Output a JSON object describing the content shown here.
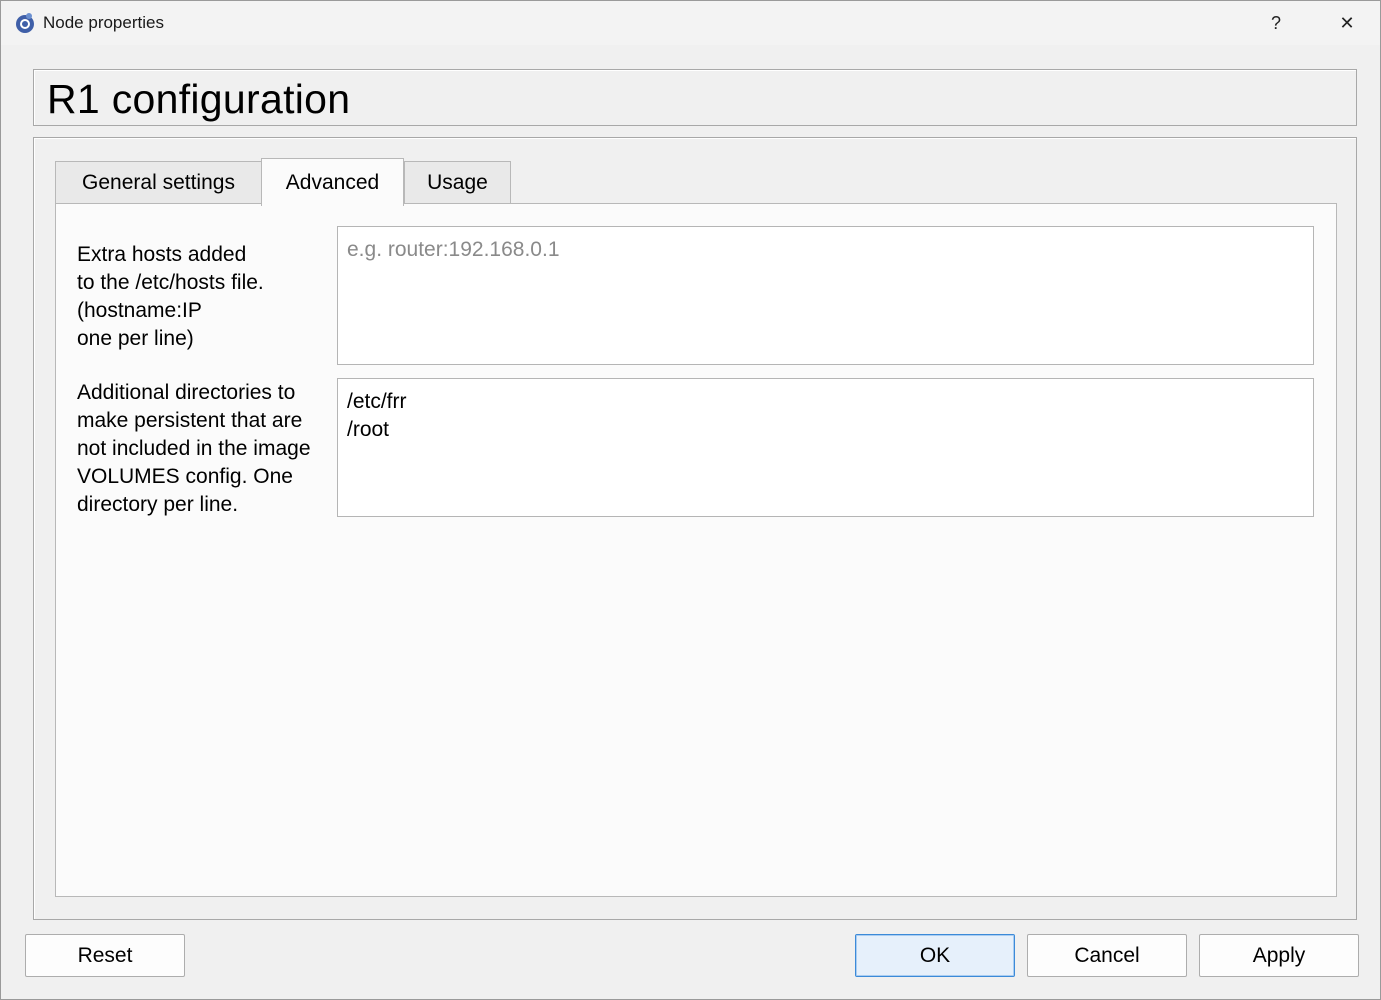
{
  "window": {
    "title": "Node properties",
    "help_glyph": "?",
    "close_glyph": "✕",
    "icon": "gns3-app-icon"
  },
  "header": {
    "title": "R1 configuration"
  },
  "tabs": [
    {
      "label": "General settings",
      "active": false
    },
    {
      "label": "Advanced",
      "active": true
    },
    {
      "label": "Usage",
      "active": false
    }
  ],
  "advanced": {
    "extra_hosts": {
      "label": "Extra hosts added\nto the /etc/hosts file.\n(hostname:IP\none per line)",
      "placeholder": "e.g. router:192.168.0.1",
      "value": ""
    },
    "extra_volumes": {
      "label": "Additional directories to\nmake persistent that are\nnot included in the image\nVOLUMES config. One\ndirectory per line.",
      "value": "/etc/frr\n/root"
    }
  },
  "buttons": {
    "reset": "Reset",
    "ok": "OK",
    "cancel": "Cancel",
    "apply": "Apply"
  }
}
